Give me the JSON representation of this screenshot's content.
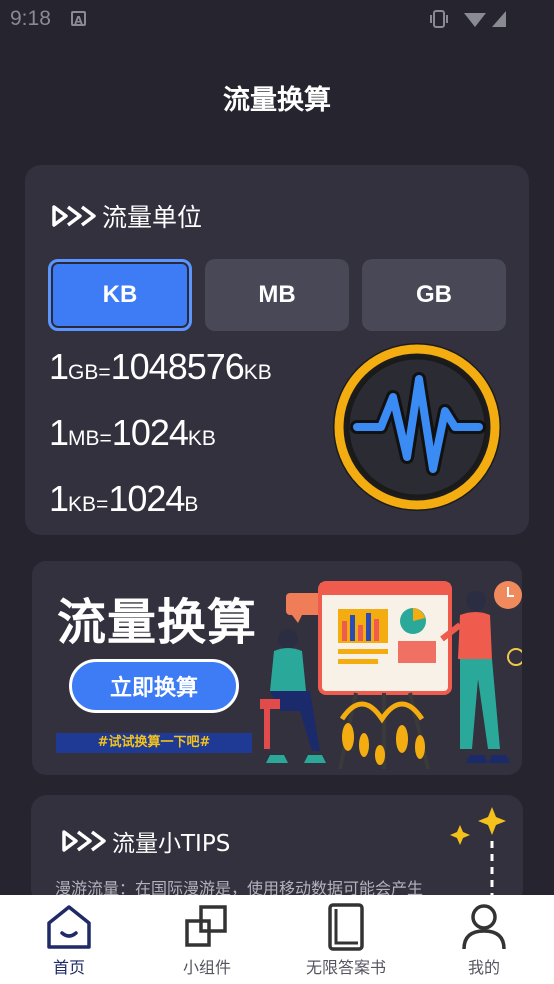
{
  "status_bar": {
    "time": "9:18",
    "notif_badge": "A"
  },
  "header": {
    "title": "流量换算"
  },
  "unit_section": {
    "heading": "流量单位",
    "buttons": [
      "KB",
      "MB",
      "GB"
    ],
    "active": "KB",
    "conversions": [
      {
        "lhs_num": "1",
        "lhs_unit": "GB",
        "eq": "=",
        "rhs_num": "1048576",
        "rhs_unit": "KB"
      },
      {
        "lhs_num": "1",
        "lhs_unit": "MB",
        "eq": "=",
        "rhs_num": "1024",
        "rhs_unit": "KB"
      },
      {
        "lhs_num": "1",
        "lhs_unit": "KB",
        "eq": "=",
        "rhs_num": "1024",
        "rhs_unit": "B"
      }
    ]
  },
  "banner": {
    "title": "流量换算",
    "button": "立即换算",
    "tag": "#试试换算一下吧#"
  },
  "tips": {
    "heading": "流量小TIPS",
    "text": "漫游流量：在国际漫游是，使用移动数据可能会产生"
  },
  "nav": {
    "items": [
      {
        "label": "首页",
        "icon": "home-icon"
      },
      {
        "label": "小组件",
        "icon": "widgets-icon"
      },
      {
        "label": "无限答案书",
        "icon": "book-icon"
      },
      {
        "label": "我的",
        "icon": "profile-icon"
      }
    ]
  },
  "colors": {
    "accent": "#3d7cf5",
    "card": "#32313d",
    "bg": "#25242f",
    "gold": "#f4ad11"
  }
}
